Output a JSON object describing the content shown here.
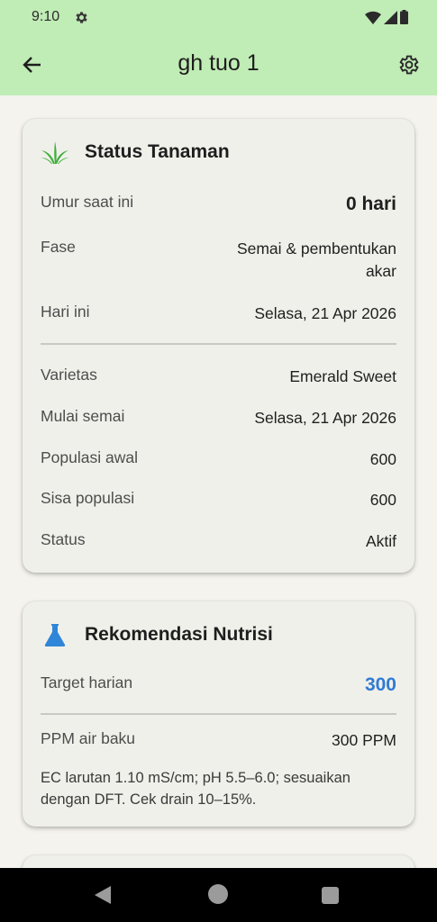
{
  "status_bar": {
    "time": "9:10"
  },
  "app_bar": {
    "title": "gh tuo 1"
  },
  "status_card": {
    "title": "Status Tanaman",
    "rows": [
      {
        "label": "Umur saat ini",
        "value": "0 hari"
      },
      {
        "label": "Fase",
        "value_line1": "Semai & pembentukan",
        "value_line2": "akar"
      },
      {
        "label": "Hari ini",
        "value": "Selasa, 21 Apr 2026"
      },
      {
        "label": "Varietas",
        "value": "Emerald Sweet"
      },
      {
        "label": "Mulai semai",
        "value": "Selasa, 21 Apr 2026"
      },
      {
        "label": "Populasi awal",
        "value": "600"
      },
      {
        "label": "Sisa populasi",
        "value": "600"
      },
      {
        "label": "Status",
        "value": "Aktif"
      }
    ]
  },
  "nutrition_card": {
    "title": "Rekomendasi Nutrisi",
    "target_label": "Target harian",
    "target_value": "300",
    "ppm_label": "PPM air baku",
    "ppm_value": "300 PPM",
    "note": "EC larutan 1.10 mS/cm; pH 5.5–6.0; sesuaikan dengan DFT. Cek drain 10–15%."
  },
  "colors": {
    "app_bar": "#c0ecb5",
    "accent": "#2f7bd3",
    "plant_icon": "#3fae3a"
  }
}
